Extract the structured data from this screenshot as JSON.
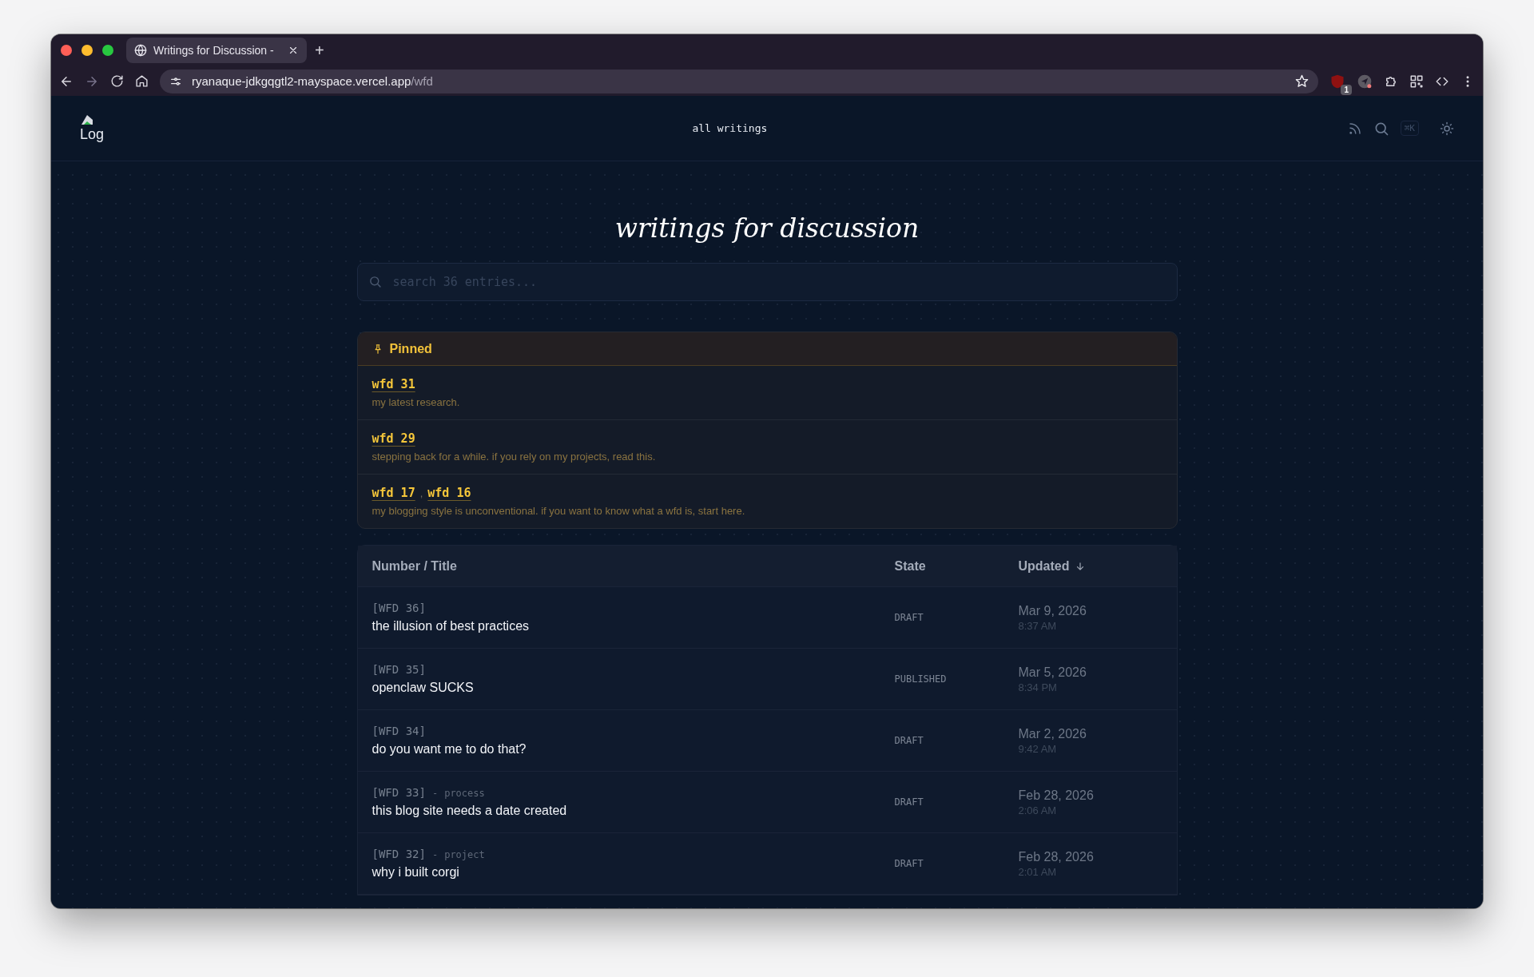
{
  "browser": {
    "tabs": [
      {
        "title": "Writings for Discussion -",
        "selected": true
      }
    ],
    "new_tab": "+",
    "url_host": "ryanaque-jdkgqgtl2-mayspace.vercel.app",
    "url_path": "/wfd",
    "extension_badge": "1"
  },
  "site_header": {
    "logo_text": "Log",
    "nav": [
      {
        "label": "all writings"
      }
    ],
    "shortcut": "⌘K"
  },
  "page_title": "writings for discussion",
  "search": {
    "placeholder": "search 36 entries..."
  },
  "pinned": {
    "label": "Pinned",
    "separator": ",",
    "items": [
      {
        "links": [
          "wfd 31"
        ],
        "description": "my latest research."
      },
      {
        "links": [
          "wfd 29"
        ],
        "description": "stepping back for a while. if you rely on my projects, read this."
      },
      {
        "links": [
          "wfd 17",
          "wfd 16"
        ],
        "description": "my blogging style is unconventional. if you want to know what a wfd is, start here."
      }
    ]
  },
  "table": {
    "columns": [
      {
        "label": "Number / Title",
        "sorted": false
      },
      {
        "label": "State",
        "sorted": false
      },
      {
        "label": "Updated",
        "sorted": true
      }
    ],
    "rows": [
      {
        "number": "[WFD 36]",
        "title": "the illusion of best practices",
        "state": "DRAFT",
        "date": "Mar 9, 2026",
        "time": "8:37 AM"
      },
      {
        "number": "[WFD 35]",
        "title": "openclaw SUCKS",
        "state": "PUBLISHED",
        "date": "Mar 5, 2026",
        "time": "8:34 PM"
      },
      {
        "number": "[WFD 34]",
        "title": "do you want me to do that?",
        "state": "DRAFT",
        "date": "Mar 2, 2026",
        "time": "9:42 AM"
      },
      {
        "number": "[WFD 33]",
        "separator": "-",
        "tag": "process",
        "title": "this blog site needs a date created",
        "state": "DRAFT",
        "date": "Feb 28, 2026",
        "time": "2:06 AM"
      },
      {
        "number": "[WFD 32]",
        "separator": "-",
        "tag": "project",
        "title": "why i built corgi",
        "state": "DRAFT",
        "date": "Feb 28, 2026",
        "time": "2:01 AM"
      }
    ]
  }
}
